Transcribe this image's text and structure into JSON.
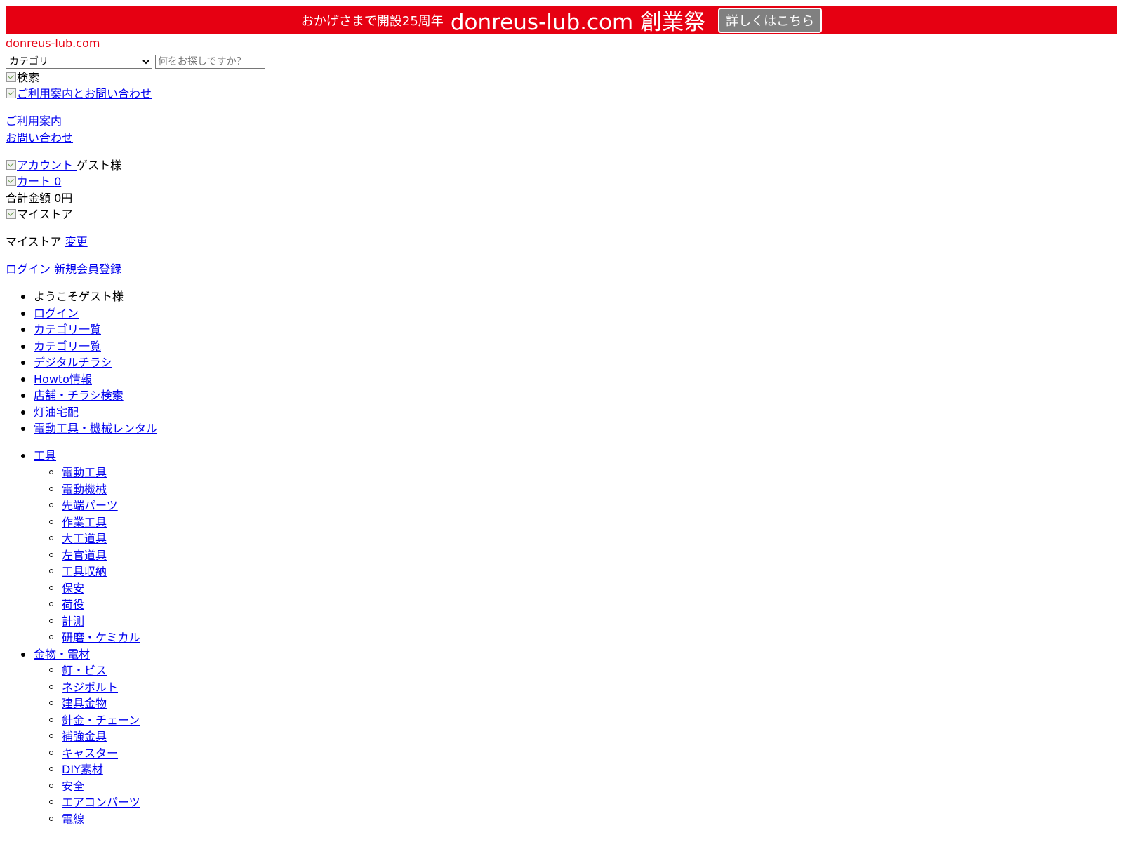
{
  "banner": {
    "small_text": "おかげさまで開設25周年",
    "big_text": "donreus-lub.com 創業祭",
    "button_label": "詳しくはこちら",
    "bg_color": "#e60012",
    "button_color": "#808080"
  },
  "site": {
    "logo_link": "donreus-lub.com"
  },
  "search": {
    "category_selected": "カテゴリ",
    "placeholder": "何をお探しですか？",
    "search_image_alt": "検索"
  },
  "header": {
    "guide_contact_image_alt": "ご利用案内とお問い合わせ",
    "guide_link": "ご利用案内",
    "contact_link": "お問い合わせ",
    "account_image_alt": "アカウント",
    "guest_label": "ゲスト様",
    "cart_image_alt": "カート",
    "cart_count": "0",
    "total_label": "合計金額",
    "total_value": "0円",
    "mystore_image_alt": "マイストア",
    "mystore_label": "マイストア",
    "mystore_change": "変更",
    "login": "ログイン",
    "register": "新規会員登録"
  },
  "nav": {
    "welcome": "ようこそゲスト様",
    "items": [
      "ログイン",
      "カテゴリ一覧",
      "カテゴリ一覧",
      "デジタルチラシ",
      "Howto情報",
      "店舗・チラシ検索",
      "灯油宅配",
      "電動工具・機械レンタル"
    ]
  },
  "categories": [
    {
      "name": "工具",
      "children": [
        "電動工具",
        "電動機械",
        "先端パーツ",
        "作業工具",
        "大工道具",
        "左官道具",
        "工具収納",
        "保安",
        "荷役",
        "計測",
        "研磨・ケミカル"
      ]
    },
    {
      "name": "金物・電材",
      "children": [
        "釘・ビス",
        "ネジボルト",
        "建具金物",
        "針金・チェーン",
        "補強金具",
        "キャスター",
        "DIY素材",
        "安全",
        "エアコンパーツ",
        "電線"
      ]
    }
  ]
}
